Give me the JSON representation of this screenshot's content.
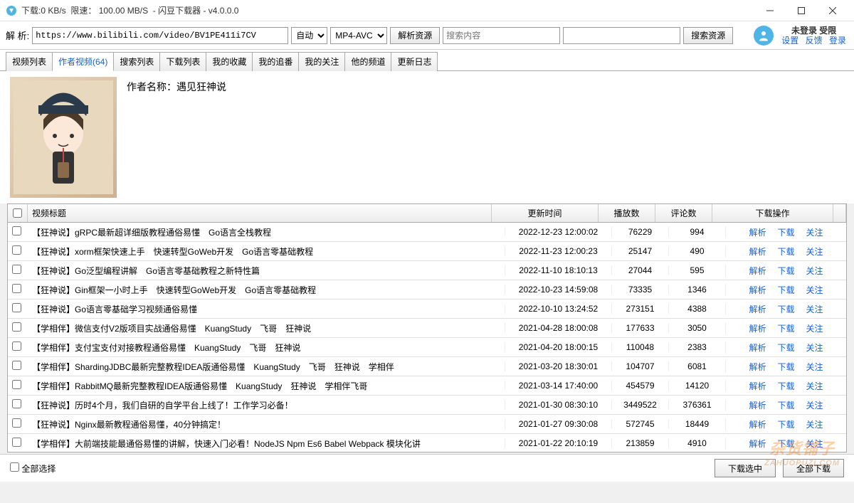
{
  "titlebar": {
    "download_speed": "下载:0 KB/s",
    "limit": "限速：",
    "limit_val": "100.00 MB/S",
    "app": "闪豆下载器",
    "version": "v4.0.0.0"
  },
  "parsebar": {
    "label": "解 析:",
    "url": "https://www.bilibili.com/video/BV1PE411i7CV",
    "mode": "自动",
    "format": "MP4-AVC",
    "parse_btn": "解析资源",
    "search_placeholder": "搜索内容",
    "search_btn": "搜索资源"
  },
  "user": {
    "status": "未登录 受限",
    "settings": "设置",
    "feedback": "反馈",
    "login": "登录"
  },
  "tabs": [
    "视频列表",
    "作者视频(64)",
    "搜索列表",
    "下载列表",
    "我的收藏",
    "我的追番",
    "我的关注",
    "他的频道",
    "更新日志"
  ],
  "active_tab_index": 1,
  "author": {
    "label": "作者名称：",
    "name": "遇见狂神说"
  },
  "columns": {
    "title": "视频标题",
    "time": "更新时间",
    "play": "播放数",
    "cmt": "评论数",
    "ops": "下载操作"
  },
  "ops": {
    "parse": "解析",
    "download": "下载",
    "follow": "关注"
  },
  "rows": [
    {
      "title": "【狂神说】gRPC最新超详细版教程通俗易懂　Go语言全栈教程",
      "time": "2022-12-23 12:00:02",
      "play": "76229",
      "cmt": "994"
    },
    {
      "title": "【狂神说】xorm框架快速上手　快速转型GoWeb开发　Go语言零基础教程",
      "time": "2022-11-23 12:00:23",
      "play": "25147",
      "cmt": "490"
    },
    {
      "title": "【狂神说】Go泛型编程讲解　Go语言零基础教程之新特性篇",
      "time": "2022-11-10 18:10:13",
      "play": "27044",
      "cmt": "595"
    },
    {
      "title": "【狂神说】Gin框架一小时上手　快速转型GoWeb开发　Go语言零基础教程",
      "time": "2022-10-23 14:59:08",
      "play": "73335",
      "cmt": "1346"
    },
    {
      "title": "【狂神说】Go语言零基础学习视频通俗易懂",
      "time": "2022-10-10 13:24:52",
      "play": "273151",
      "cmt": "4388"
    },
    {
      "title": "【学相伴】微信支付V2版项目实战通俗易懂　KuangStudy　飞哥　狂神说",
      "time": "2021-04-28 18:00:08",
      "play": "177633",
      "cmt": "3050"
    },
    {
      "title": "【学相伴】支付宝支付对接教程通俗易懂　KuangStudy　飞哥　狂神说",
      "time": "2021-04-20 18:00:15",
      "play": "110048",
      "cmt": "2383"
    },
    {
      "title": "【学相伴】ShardingJDBC最新完整教程IDEA版通俗易懂　KuangStudy　飞哥　狂神说　学相伴",
      "time": "2021-03-20 18:30:01",
      "play": "104707",
      "cmt": "6081"
    },
    {
      "title": "【学相伴】RabbitMQ最新完整教程IDEA版通俗易懂　KuangStudy　狂神说　学相伴飞哥",
      "time": "2021-03-14 17:40:00",
      "play": "454579",
      "cmt": "14120"
    },
    {
      "title": "【狂神说】历时4个月，我们自研的自学平台上线了！工作学习必备！",
      "time": "2021-01-30 08:30:10",
      "play": "3449522",
      "cmt": "376361"
    },
    {
      "title": "【狂神说】Nginx最新教程通俗易懂，40分钟搞定！",
      "time": "2021-01-27 09:30:08",
      "play": "572745",
      "cmt": "18449"
    },
    {
      "title": "【学相伴】大前端技能最通俗易懂的讲解，快速入门必看！NodeJS Npm Es6 Babel Webpack 模块化讲",
      "time": "2021-01-22 20:10:19",
      "play": "213859",
      "cmt": "4910"
    }
  ],
  "footer": {
    "select_all": "全部选择",
    "download_selected": "下载选中",
    "download_all": "全部下载"
  },
  "watermark": {
    "main": "杂货铺子",
    "sub": "ZAHUOPUZI.COM"
  }
}
